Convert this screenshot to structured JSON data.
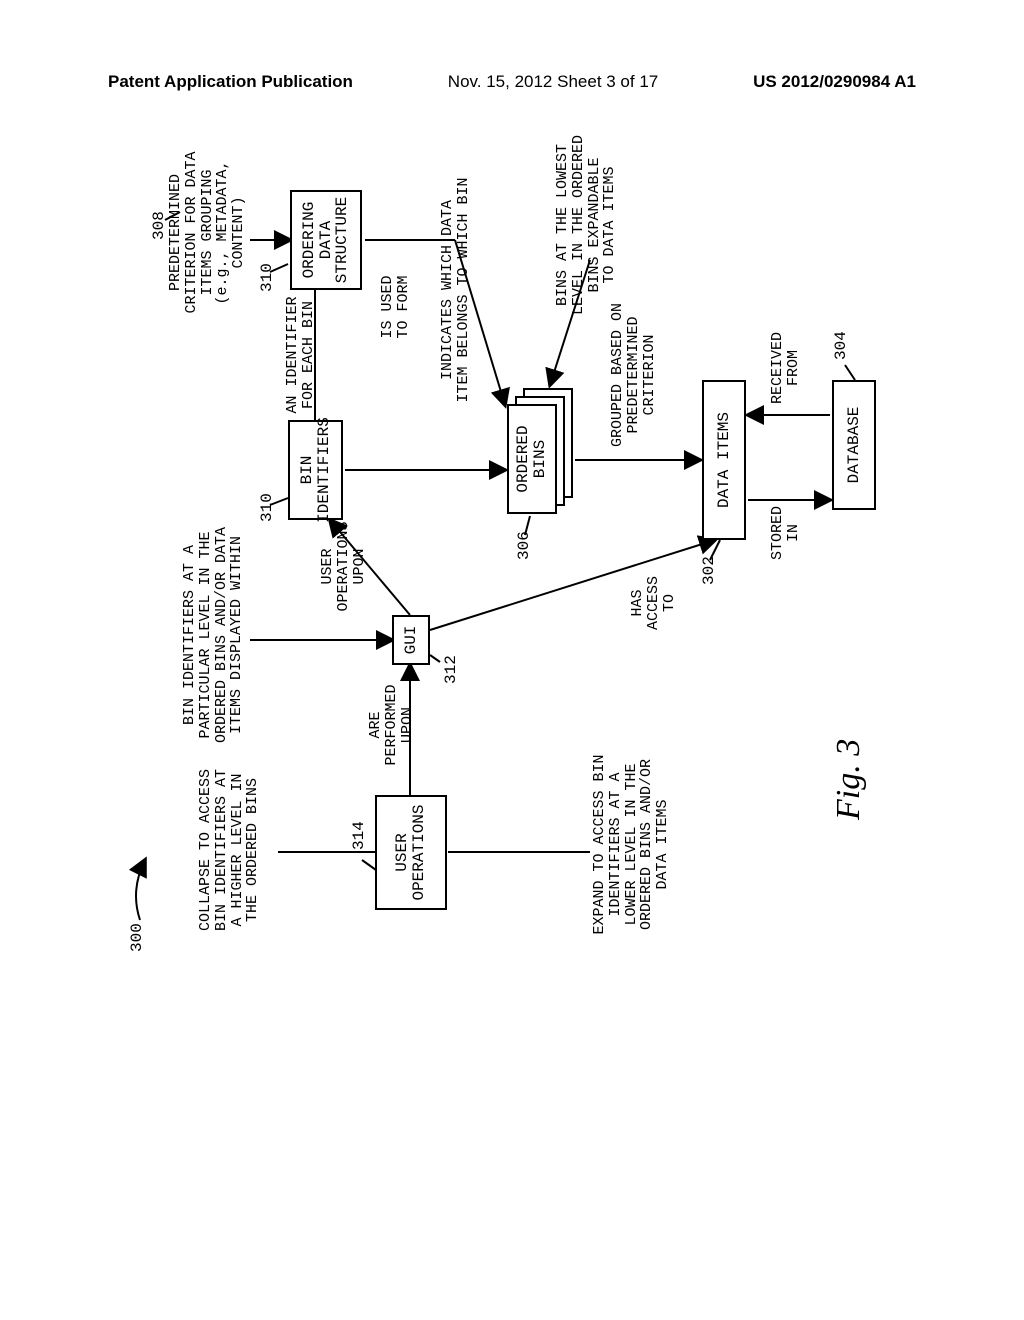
{
  "header": {
    "left": "Patent Application Publication",
    "center": "Nov. 15, 2012  Sheet 3 of 17",
    "right": "US 2012/0290984 A1"
  },
  "diagram": {
    "fig_num": "300",
    "caption": "Fig. 3",
    "refs": {
      "r302": "302",
      "r304": "304",
      "r306": "306",
      "r308": "308",
      "r310a": "310",
      "r310b": "310",
      "r312": "312",
      "r314": "314"
    },
    "boxes": {
      "user_operations": "USER\nOPERATIONS",
      "gui": "GUI",
      "bin_identifiers": "BIN\nIDENTIFIERS",
      "ordering_ds": "ORDERING\nDATA\nSTRUCTURE",
      "ordered_bins0": "",
      "ordered_bins1": "",
      "ordered_bins_top": "ORDERED\nBINS",
      "data_items": "DATA ITEMS",
      "database": "DATABASE"
    },
    "labels": {
      "collapse": "COLLAPSE TO ACCESS\nBIN IDENTIFIERS AT\nA HIGHER LEVEL IN\nTHE ORDERED BINS",
      "expand": "EXPAND TO ACCESS BIN\nIDENTIFIERS AT A\nLOWER LEVEL IN THE\nORDERED BINS AND/OR\nDATA ITEMS",
      "performed_upon": "ARE\nPERFORMED\nUPON",
      "user_ops_upon": "USER\nOPERATIONS\nUPON",
      "gui_top": "BIN IDENTIFIERS AT A\nPARTICULAR LEVEL IN THE\nORDERED BINS AND/OR DATA\nITEMS DISPLAYED WITHIN",
      "id_each_bin": "AN IDENTIFIER\nFOR EACH BIN",
      "is_used_to_form": "IS USED\nTO FORM",
      "criterion": "PREDETERMINED\nCRITERION FOR DATA\nITEMS GROUPING\n(e.g., METADATA,\nCONTENT)",
      "indicates": "INDICATES WHICH DATA\nITEM BELONGS TO WHICH BIN",
      "bins_lowest": "BINS AT THE LOWEST\nLEVEL IN THE ORDERED\nBINS EXPANDABLE\nTO DATA ITEMS",
      "grouped": "GROUPED BASED ON\nPREDETERMINED\nCRITERION",
      "has_access": "HAS\nACCESS\nTO",
      "stored_in": "STORED\nIN",
      "received_from": "RECEIVED\nFROM"
    }
  }
}
